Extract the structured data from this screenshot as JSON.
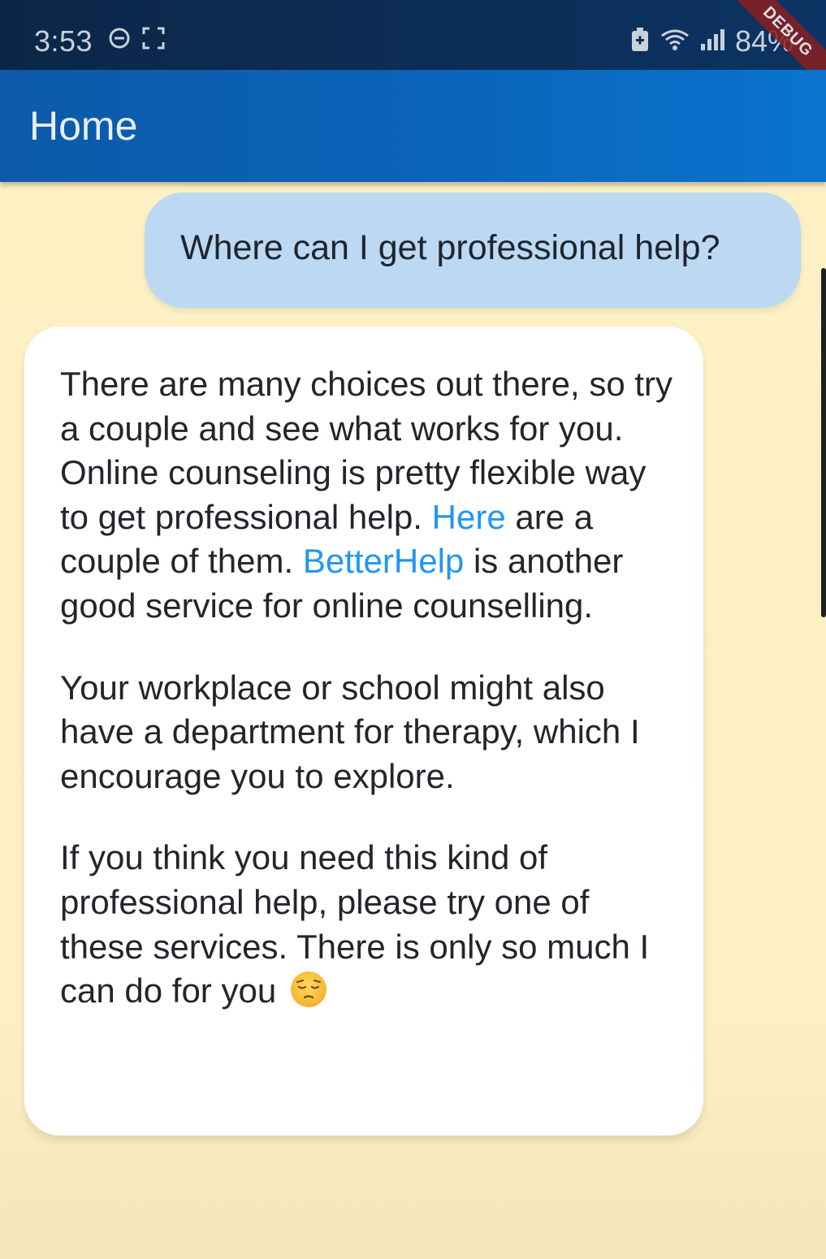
{
  "status_bar": {
    "time": "3:53",
    "battery": "84%",
    "icons_left": [
      "do-not-disturb-icon",
      "screenshot-icon"
    ],
    "icons_right": [
      "battery-saver-icon",
      "wifi-icon",
      "signal-icon"
    ],
    "debug_label": "DEBUG"
  },
  "app_bar": {
    "title": "Home"
  },
  "chat": {
    "user_message": "Where can I get professional help?",
    "bot_message": {
      "p1_line1": "There are many choices out there, so try a couple and see what works for you.",
      "p1_line2_a": "Online counseling is pretty flexible way to get professional help. ",
      "p1_link_here": "Here",
      "p1_line2_b": " are a couple of them. ",
      "p1_link_betterhelp": "BetterHelp",
      "p1_line2_c": " is another good service for online counselling.",
      "p2": "Your workplace or school might also have a department for therapy, which I encourage you to explore.",
      "p3": "If you think you need this kind of professional help, please try one of these services. There is only so much I can do for you",
      "emoji": "pensive-face-emoji"
    }
  },
  "colors": {
    "background": "#fdf1c4",
    "app_bar": "#0a63b8",
    "status_bar": "#0c2d55",
    "user_bubble": "#bcd8f3",
    "bot_bubble": "#ffffff",
    "link": "#2196f3"
  }
}
